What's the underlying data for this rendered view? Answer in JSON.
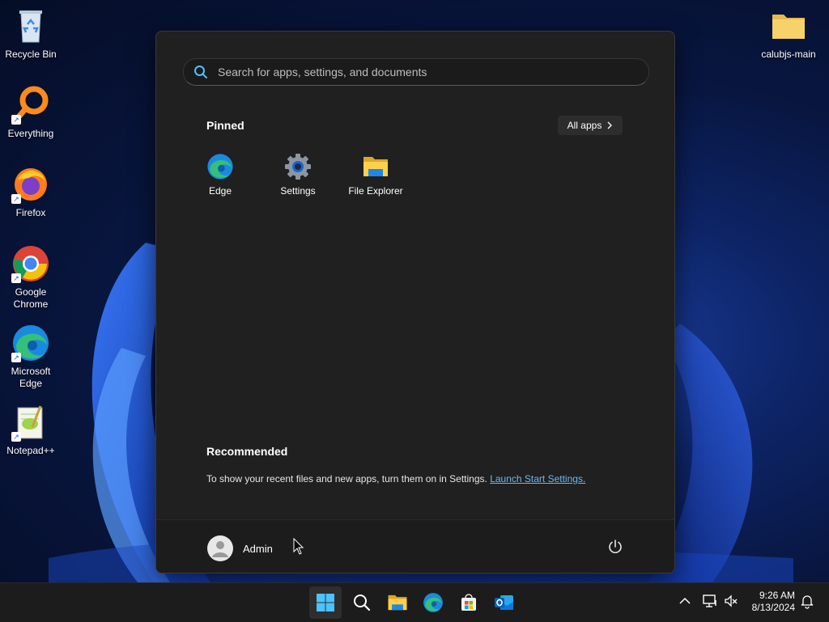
{
  "desktop": {
    "icons": [
      {
        "label": "Recycle Bin",
        "icon": "recycle-bin-icon"
      },
      {
        "label": "Everything",
        "icon": "everything-search-icon"
      },
      {
        "label": "Firefox",
        "icon": "firefox-icon"
      },
      {
        "label": "Google Chrome",
        "icon": "chrome-icon"
      },
      {
        "label": "Microsoft Edge",
        "icon": "edge-icon"
      },
      {
        "label": "Notepad++",
        "icon": "notepad-plus-plus-icon"
      },
      {
        "label": "calubjs-main",
        "icon": "folder-icon"
      }
    ]
  },
  "start_menu": {
    "search_placeholder": "Search for apps, settings, and documents",
    "pinned_title": "Pinned",
    "all_apps_label": "All apps",
    "pinned": [
      {
        "label": "Edge",
        "icon": "edge-icon"
      },
      {
        "label": "Settings",
        "icon": "settings-gear-icon"
      },
      {
        "label": "File Explorer",
        "icon": "file-explorer-icon"
      }
    ],
    "recommended_title": "Recommended",
    "recommended_text": "To show your recent files and new apps, turn them on in Settings.",
    "recommended_link": "Launch Start Settings.",
    "user_name": "Admin"
  },
  "taskbar": {
    "apps": [
      "start-icon",
      "search-icon",
      "file-explorer-icon",
      "edge-icon",
      "microsoft-store-icon",
      "outlook-icon"
    ],
    "time": "9:26 AM",
    "date": "8/13/2024"
  },
  "colors": {
    "accent": "#4cc2ff",
    "start_bg": "#202020",
    "link": "#6cb8f0"
  }
}
